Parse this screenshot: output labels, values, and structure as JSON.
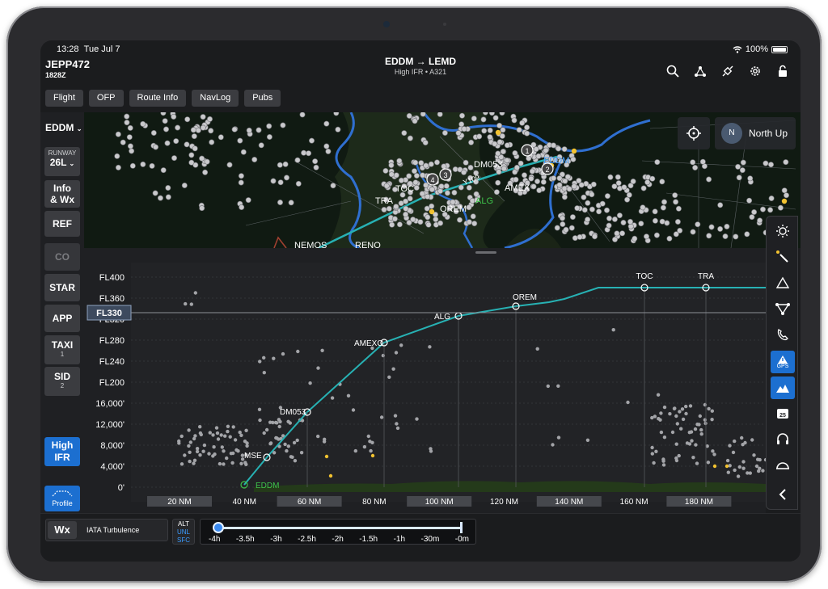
{
  "status": {
    "time": "13:28",
    "date": "Tue Jul 7",
    "battery": "100%"
  },
  "header": {
    "callsign": "JEPP472",
    "zulu": "1828Z",
    "route": "EDDM → LEMD",
    "subtitle": "High IFR • A321",
    "icons": [
      "search-icon",
      "route-network-icon",
      "satellite-icon",
      "settings-gear-icon",
      "unlock-icon"
    ]
  },
  "tabs": [
    "Flight",
    "OFP",
    "Route Info",
    "NavLog",
    "Pubs"
  ],
  "left_rail": {
    "airport": "EDDM",
    "runway_caption": "RUNWAY",
    "runway": "26L",
    "info_wx": [
      "Info",
      "& Wx"
    ],
    "ref": "REF",
    "co": "CO",
    "star": "STAR",
    "app": "APP",
    "taxi": {
      "label": "TAXI",
      "count": "1"
    },
    "sid": {
      "label": "SID",
      "count": "2"
    },
    "high_ifr": [
      "High",
      "IFR"
    ],
    "profile": "Profile"
  },
  "map": {
    "north_up": "North Up",
    "compass": "N",
    "labels": [
      "DM053",
      "AMEX",
      "ALG",
      "TRA",
      "REM",
      "OREM",
      "EDDM",
      "Y109",
      "NEMOS",
      "RENO",
      "TOC",
      "600"
    ],
    "waypoint_markers": [
      "1",
      "2",
      "3",
      "4"
    ]
  },
  "profile": {
    "current_level": "FL330",
    "y_labels": [
      "FL400",
      "FL360",
      "FL320",
      "FL280",
      "FL240",
      "FL200",
      "16,000'",
      "12,000'",
      "8,000'",
      "4,000'",
      "0'"
    ],
    "x_labels": [
      "20 NM",
      "40 NM",
      "60 NM",
      "80 NM",
      "100 NM",
      "120 NM",
      "140 NM",
      "160 NM",
      "180 NM"
    ],
    "waypoints": [
      "EDDM",
      "MSE",
      "DM053",
      "AMEXO",
      "ALG",
      "OREM",
      "TOC",
      "TRA"
    ],
    "route_color": "#27b1b3"
  },
  "right_tools": [
    "sun-brightness-icon",
    "pen-draw-icon",
    "triangle-icon",
    "airspace-icon",
    "phone-frequency-icon",
    "gps-warning-icon",
    "terrain-icon",
    "airport-25-icon",
    "headset-icon",
    "dome-icon",
    "chevron-left-icon"
  ],
  "gps_label": "GPS",
  "bottom": {
    "wx_button": "Wx",
    "wx_layer": "IATA Turbulence",
    "alt_options": [
      "ALT",
      "UNL",
      "SFC"
    ],
    "time_labels": [
      "-4h",
      "-3.5h",
      "-3h",
      "-2.5h",
      "-2h",
      "-1.5h",
      "-1h",
      "-30m",
      "-0m"
    ]
  }
}
